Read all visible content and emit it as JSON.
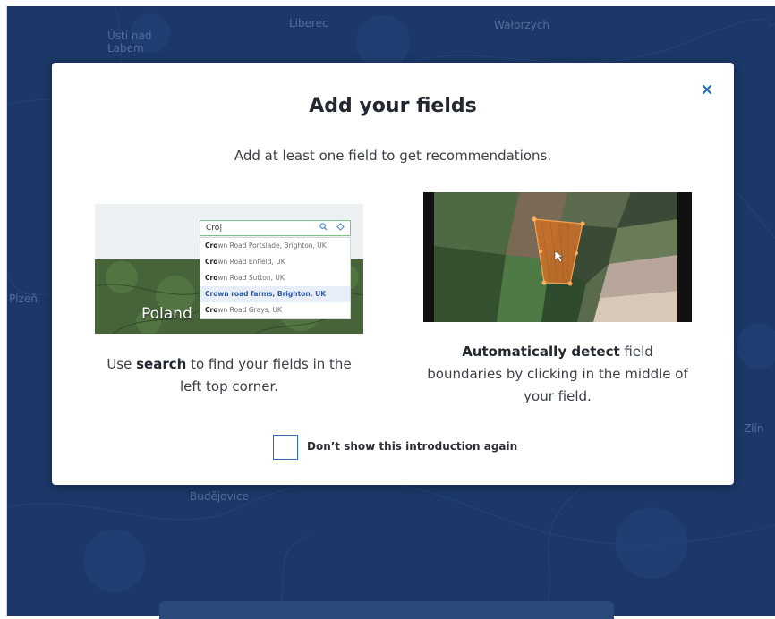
{
  "map": {
    "cities": [
      "Ústí nad Labem",
      "Liberec",
      "Wałbrzych",
      "Plzeň",
      "Budějovice",
      "Zlín"
    ]
  },
  "modal": {
    "title": "Add your fields",
    "subtitle": "Add at least one field to get recommendations.",
    "close_icon": "close-icon",
    "search_card": {
      "search_value": "Cro|",
      "results": [
        {
          "bold": "Cro",
          "rest": "wn Road Portslade, Brighton, UK"
        },
        {
          "bold": "Cro",
          "rest": "wn Road Enfield, UK"
        },
        {
          "bold": "Cro",
          "rest": "wn Road Sutton, UK"
        },
        {
          "bold": "Cro",
          "rest": "wn road farms, Brighton, UK"
        },
        {
          "bold": "Cro",
          "rest": "wn Road Grays, UK"
        }
      ],
      "selected_index": 3,
      "map_label": "Poland",
      "desc_pre": "Use ",
      "desc_bold": "search",
      "desc_post": " to find your fields in the left top corner."
    },
    "detect_card": {
      "desc_bold": "Automatically detect",
      "desc_post": " field boundaries by clicking in the middle of your field."
    },
    "checkbox_label": "Don’t show this introduction again",
    "checkbox_checked": false
  },
  "colors": {
    "map_background": "#1c3868",
    "accent": "#2b6fb0",
    "field_highlight": "#c8702a"
  }
}
